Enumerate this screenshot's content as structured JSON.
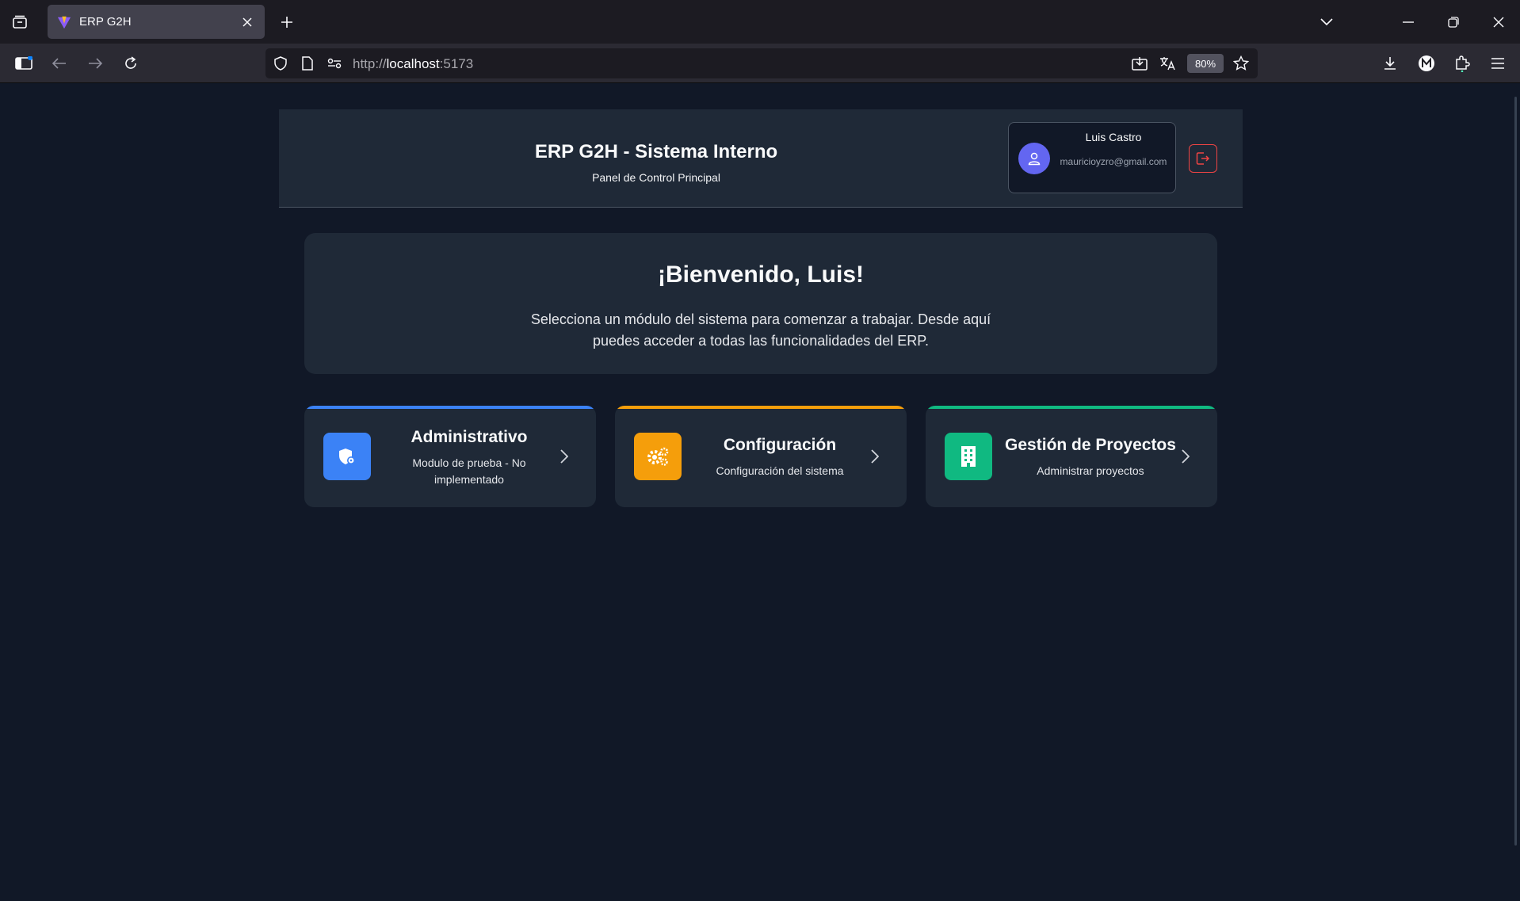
{
  "browser": {
    "tab_title": "ERP G2H",
    "url_scheme": "http://",
    "url_host": "localhost",
    "url_port": ":5173",
    "zoom": "80%"
  },
  "header": {
    "title": "ERP G2H - Sistema Interno",
    "subtitle": "Panel de Control Principal",
    "user_name": "Luis Castro",
    "user_email": "mauricioyzro@gmail.com"
  },
  "welcome": {
    "title": "¡Bienvenido, Luis!",
    "message": "Selecciona un módulo del sistema para comenzar a trabajar. Desde aquí puedes acceder a todas las funcionalidades del ERP."
  },
  "modules": [
    {
      "title": "Administrativo",
      "description": "Modulo de prueba - No implementado",
      "color": "#3b82f6",
      "icon": "shield-gear-icon"
    },
    {
      "title": "Configuración",
      "description": "Configuración del sistema",
      "color": "#f59e0b",
      "icon": "gears-icon"
    },
    {
      "title": "Gestión de Proyectos",
      "description": "Administrar proyectos",
      "color": "#10b981",
      "icon": "building-icon"
    }
  ],
  "colors": {
    "page_bg": "#111827",
    "card_bg": "#1f2937",
    "avatar": "#6366f1",
    "logout": "#ef4444"
  }
}
